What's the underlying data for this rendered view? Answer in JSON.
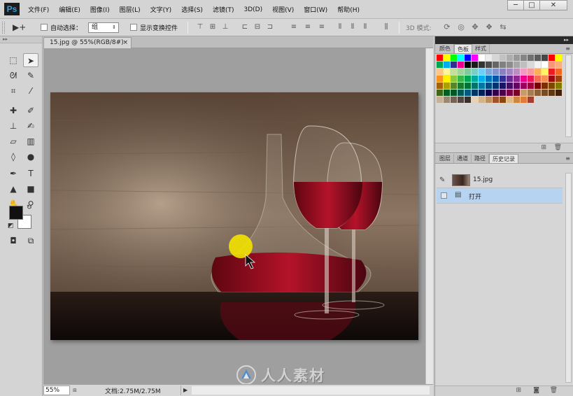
{
  "app": {
    "logo": "Ps"
  },
  "menu": [
    "文件(F)",
    "编辑(E)",
    "图像(I)",
    "图层(L)",
    "文字(Y)",
    "选择(S)",
    "滤镜(T)",
    "3D(D)",
    "视图(V)",
    "窗口(W)",
    "帮助(H)"
  ],
  "window_controls": {
    "minimize": "─",
    "maximize": "□",
    "close": "✕"
  },
  "options": {
    "move_tool_icon": "▶+",
    "auto_select_label": "自动选择：",
    "auto_select_value": "组",
    "show_transform_label": "显示变换控件",
    "mode_3d_label": "3D 模式:"
  },
  "document": {
    "tab_title": "15.jpg @ 55%(RGB/8#)",
    "tab_close": "×",
    "zoom": "55%",
    "doc_info": "文档:2.75M/2.75M"
  },
  "watermark": {
    "text": "人人素材"
  },
  "swatches_panel": {
    "tabs": [
      "颜色",
      "色板",
      "样式"
    ],
    "active_tab": 1,
    "menu_icon": "≡",
    "colors": [
      "#ff0000",
      "#ffff00",
      "#00ff00",
      "#00ffff",
      "#0000ff",
      "#ff00ff",
      "#ffffff",
      "#ebebeb",
      "#d6d6d6",
      "#c2c2c2",
      "#adadad",
      "#999999",
      "#858585",
      "#707070",
      "#5c5c5c",
      "#474747",
      "#ff0000",
      "#ffff00",
      "#00a651",
      "#00aeef",
      "#2e3192",
      "#ec008c",
      "#000000",
      "#1a1a1a",
      "#333333",
      "#4d4d4d",
      "#666666",
      "#808080",
      "#8c8c8c",
      "#a6a6a6",
      "#bfbfbf",
      "#d9d9d9",
      "#f2f2f2",
      "#ffffff",
      "#f7977a",
      "#f9ad81",
      "#fdc68a",
      "#fff79a",
      "#c4df9b",
      "#a3d39c",
      "#82ca9d",
      "#7bcdc8",
      "#6ecff6",
      "#7ea7d8",
      "#8493ca",
      "#8882be",
      "#a187be",
      "#bc8dbf",
      "#f49ac2",
      "#f6989d",
      "#fbaf5d",
      "#fff467",
      "#ed1c24",
      "#f26522",
      "#f7941d",
      "#fff200",
      "#8dc63f",
      "#39b54a",
      "#00a651",
      "#00a99d",
      "#00aeef",
      "#0072bc",
      "#0054a6",
      "#2e3192",
      "#662d91",
      "#92278f",
      "#ec008c",
      "#ed145b",
      "#f26c4f",
      "#f68e56",
      "#9e0b0f",
      "#a0410d",
      "#a36209",
      "#aba000",
      "#598527",
      "#1a7b30",
      "#007236",
      "#00746b",
      "#0076a3",
      "#004b80",
      "#003471",
      "#1b1464",
      "#440e62",
      "#630460",
      "#9e005d",
      "#9e0039",
      "#790000",
      "#7b2e00",
      "#7d4900",
      "#827b00",
      "#406618",
      "#005e20",
      "#005826",
      "#005952",
      "#005b7f",
      "#003663",
      "#002157",
      "#0d004c",
      "#32004b",
      "#4b0049",
      "#7b0046",
      "#7a0026",
      "#c69c6d",
      "#a67c52",
      "#8c6239",
      "#754c24",
      "#603913",
      "#42210b",
      "#c7b299",
      "#998675",
      "#736357",
      "#534741",
      "#37302d",
      "#e6d1b9",
      "#d2b48c",
      "#bc8f5f",
      "#a0522d",
      "#8b4513",
      "#deb887",
      "#cd853f",
      "#e07b39",
      "#a04030"
    ]
  },
  "history_panel": {
    "tabs": [
      "图层",
      "通道",
      "路径",
      "历史记录"
    ],
    "active_tab": 3,
    "menu_icon": "≡",
    "snapshot_label": "15.jpg",
    "steps": [
      "打开"
    ]
  },
  "icons": {
    "brush": "✎",
    "doc": "▤",
    "trash": "🗑",
    "new": "⊞",
    "camera": "◙"
  }
}
